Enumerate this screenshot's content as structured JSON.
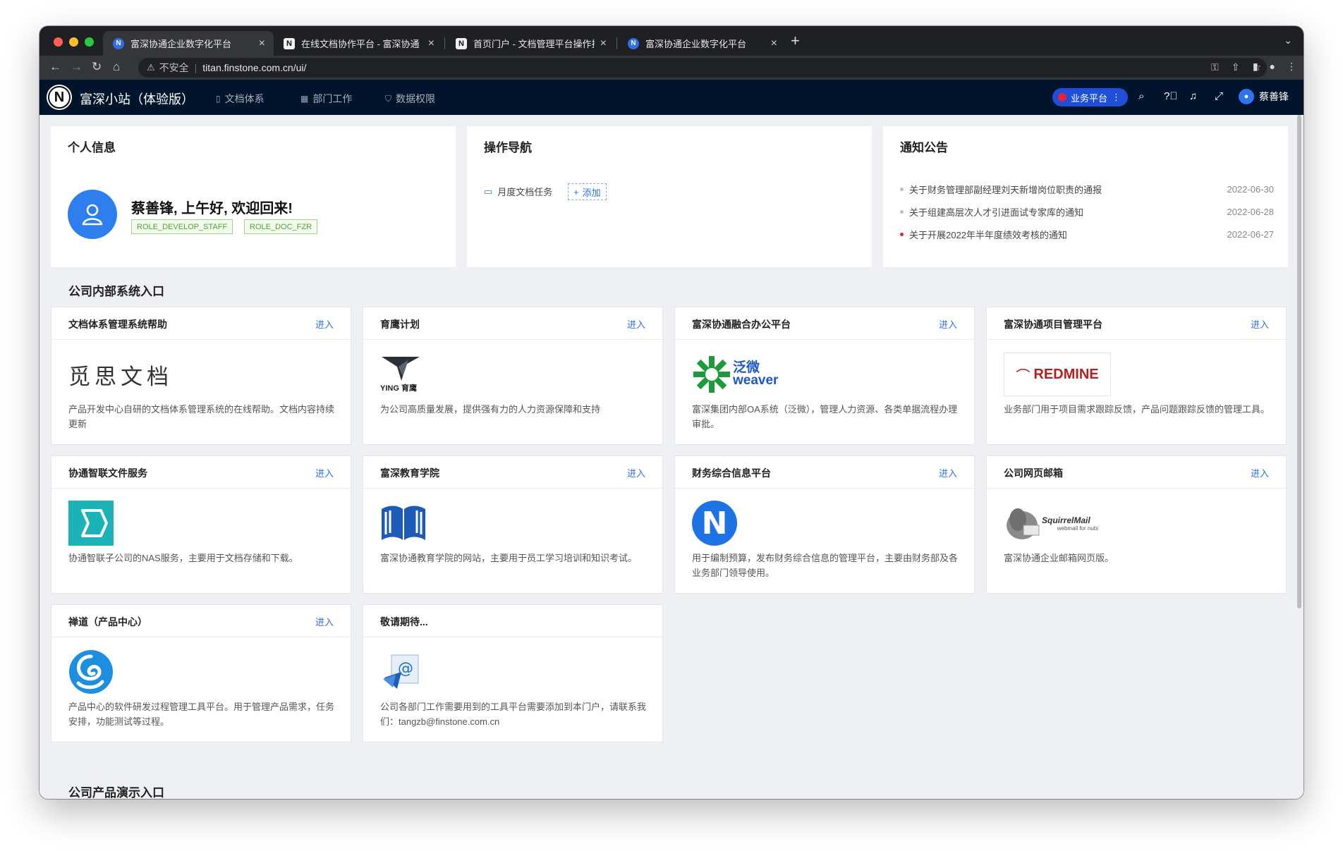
{
  "browser": {
    "tabs": [
      {
        "title": "富深协通企业数字化平台",
        "favicon": "n-logo",
        "active": true
      },
      {
        "title": "在线文档协作平台 - 富深协通",
        "favicon": "doc-logo",
        "active": false
      },
      {
        "title": "首页门户 - 文档管理平台操作指",
        "favicon": "doc-logo",
        "active": false
      },
      {
        "title": "富深协通企业数字化平台",
        "favicon": "n-logo",
        "active": false
      }
    ],
    "insecure_label": "不安全",
    "url": "titan.finstone.com.cn/ui/"
  },
  "app": {
    "brand": "富深小站（体验版）",
    "menu": [
      {
        "label": "文档体系",
        "icon": "document-icon"
      },
      {
        "label": "部门工作",
        "icon": "grid-icon"
      },
      {
        "label": "数据权限",
        "icon": "shield-icon"
      }
    ],
    "platform_button": "业务平台",
    "user_name": "蔡善锋"
  },
  "profile": {
    "title": "个人信息",
    "greeting": "蔡善锋, 上午好, 欢迎回来!",
    "roles": [
      "ROLE_DEVELOP_STAFF",
      "ROLE_DOC_FZR"
    ]
  },
  "operations": {
    "title": "操作导航",
    "link": "月度文档任务",
    "add_label": "添加"
  },
  "notices": {
    "title": "通知公告",
    "items": [
      {
        "text": "关于财务管理部副经理刘天新增岗位职责的通报",
        "date": "2022-06-30",
        "dot_color": "#bfbfbf"
      },
      {
        "text": "关于组建高层次人才引进面试专家库的通知",
        "date": "2022-06-28",
        "dot_color": "#bfbfbf"
      },
      {
        "text": "关于开展2022年半年度绩效考核的通知",
        "date": "2022-06-27",
        "dot_color": "#e0243c"
      }
    ]
  },
  "systems": {
    "title": "公司内部系统入口",
    "enter_label": "进入",
    "cards": [
      {
        "title": "文档体系管理系统帮助",
        "logo": "觅思文档",
        "desc": "产品开发中心自研的文档体系管理系统的在线帮助。文档内容持续更新"
      },
      {
        "title": "育鹰计划",
        "logo": "YING 育鹰",
        "desc": "为公司高质量发展，提供强有力的人力资源保障和支持"
      },
      {
        "title": "富深协通融合办公平台",
        "logo": "泛微 weaver",
        "desc": "富深集团内部OA系统（泛微），管理人力资源、各类单据流程办理审批。"
      },
      {
        "title": "富深协通项目管理平台",
        "logo": "REDMINE",
        "desc": "业务部门用于项目需求跟踪反馈，产品问题跟踪反馈的管理工具。"
      },
      {
        "title": "协通智联文件服务",
        "logo": "nas-icon",
        "desc": "协通智联子公司的NAS服务，主要用于文档存储和下载。"
      },
      {
        "title": "富深教育学院",
        "logo": "book-icon",
        "desc": "富深协通教育学院的网站，主要用于员工学习培训和知识考试。"
      },
      {
        "title": "财务综合信息平台",
        "logo": "N",
        "desc": "用于编制预算，发布财务综合信息的管理平台，主要由财务部及各业务部门领导使用。"
      },
      {
        "title": "公司网页邮箱",
        "logo": "SquirrelMail",
        "logo_sub": "webmail for nuts",
        "desc": "富深协通企业邮箱网页版。"
      },
      {
        "title": "禅道（产品中心）",
        "logo": "zentao-icon",
        "desc": "产品中心的软件研发过程管理工具平台。用于管理产品需求，任务安排，功能测试等过程。"
      },
      {
        "title": "敬请期待...",
        "logo": "mail-icon",
        "desc": "公司各部门工作需要用到的工具平台需要添加到本门户，请联系我们：tangzb@finstone.com.cn"
      }
    ]
  },
  "products": {
    "title": "公司产品演示入口"
  }
}
